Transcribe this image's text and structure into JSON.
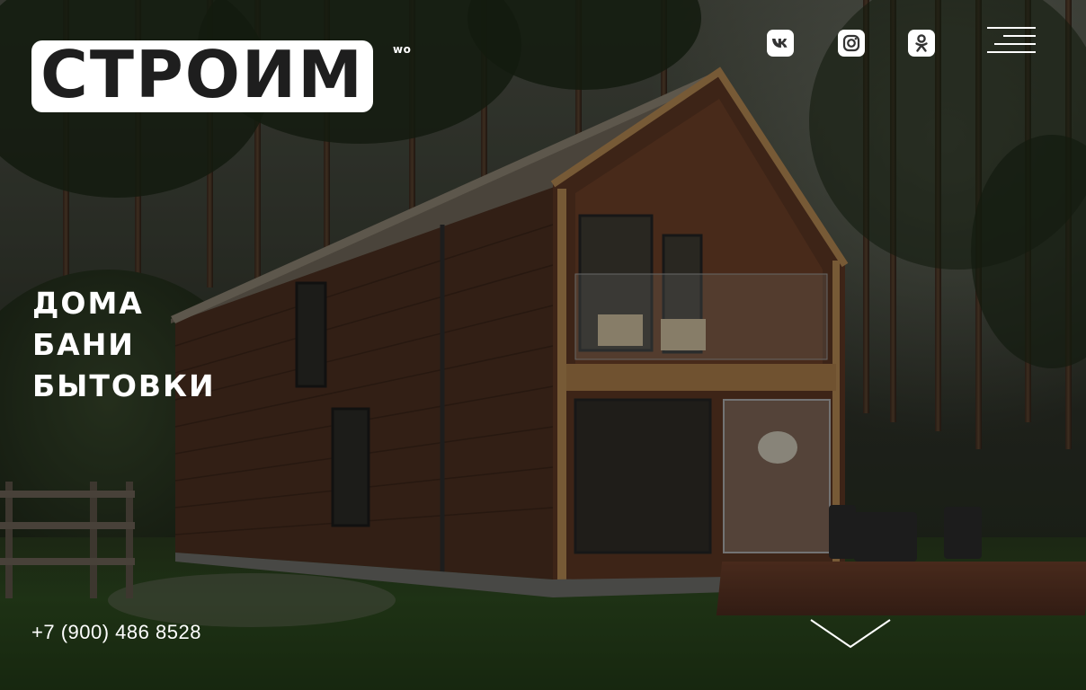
{
  "header": {
    "logo_text": "СТРОИМ",
    "logo_superscript": "wo",
    "social": [
      {
        "label": "vk",
        "icon": "vk-icon"
      },
      {
        "label": "instagram",
        "icon": "instagram-icon"
      },
      {
        "label": "odnoklassniki",
        "icon": "odnoklassniki-icon"
      }
    ],
    "menu_icon": "hamburger-menu-icon"
  },
  "hero": {
    "taglines": [
      "ДОМА",
      "БАНИ",
      "БЫТОВКИ"
    ],
    "phone": "+7 (900) 486 8528",
    "scroll_icon": "chevron-down-icon"
  },
  "colors": {
    "text": "#ffffff",
    "logo_bg": "#ffffff",
    "logo_text": "#1e1e1e",
    "overlay": "#000000"
  }
}
